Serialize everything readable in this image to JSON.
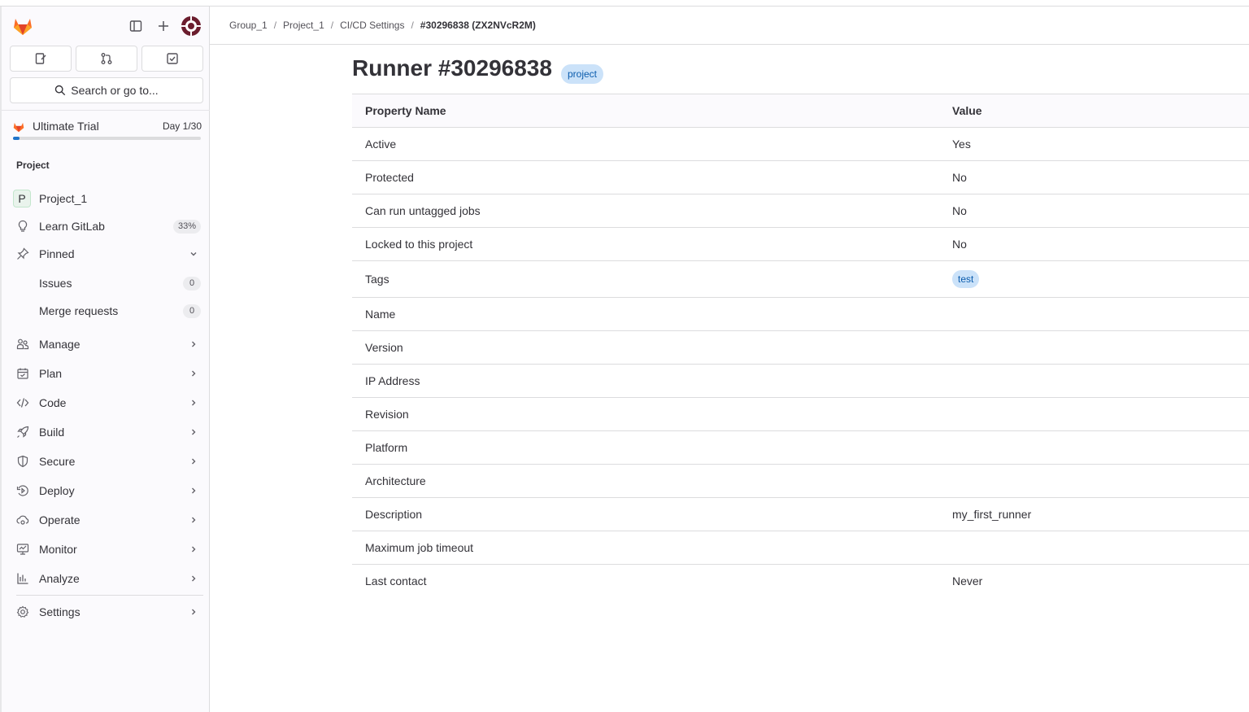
{
  "breadcrumb": [
    "Group_1",
    "Project_1",
    "CI/CD Settings",
    "#30296838 (ZX2NVcR2M)"
  ],
  "search": {
    "label": "Search or go to..."
  },
  "trial": {
    "title": "Ultimate Trial",
    "day": "Day 1/30",
    "progress": 0.033
  },
  "sidebar": {
    "section": "Project",
    "project": {
      "letter": "P",
      "name": "Project_1"
    },
    "learn": {
      "label": "Learn GitLab",
      "badge": "33%"
    },
    "pinned": {
      "label": "Pinned"
    },
    "pinned_items": [
      {
        "label": "Issues",
        "count": "0"
      },
      {
        "label": "Merge requests",
        "count": "0"
      }
    ],
    "items": [
      {
        "label": "Manage",
        "icon": "users-icon"
      },
      {
        "label": "Plan",
        "icon": "calendar-icon"
      },
      {
        "label": "Code",
        "icon": "code-icon"
      },
      {
        "label": "Build",
        "icon": "rocket-icon"
      },
      {
        "label": "Secure",
        "icon": "shield-icon"
      },
      {
        "label": "Deploy",
        "icon": "deploy-icon"
      },
      {
        "label": "Operate",
        "icon": "cloud-gear-icon"
      },
      {
        "label": "Monitor",
        "icon": "monitor-icon"
      },
      {
        "label": "Analyze",
        "icon": "chart-icon"
      }
    ],
    "settings": {
      "label": "Settings"
    }
  },
  "page": {
    "title": "Runner #30296838",
    "scope_badge": "project"
  },
  "table": {
    "headers": [
      "Property Name",
      "Value"
    ],
    "rows": [
      {
        "name": "Active",
        "value": "Yes"
      },
      {
        "name": "Protected",
        "value": "No"
      },
      {
        "name": "Can run untagged jobs",
        "value": "No"
      },
      {
        "name": "Locked to this project",
        "value": "No"
      },
      {
        "name": "Tags",
        "value": "test"
      },
      {
        "name": "Name",
        "value": ""
      },
      {
        "name": "Version",
        "value": ""
      },
      {
        "name": "IP Address",
        "value": ""
      },
      {
        "name": "Revision",
        "value": ""
      },
      {
        "name": "Platform",
        "value": ""
      },
      {
        "name": "Architecture",
        "value": ""
      },
      {
        "name": "Description",
        "value": "my_first_runner"
      },
      {
        "name": "Maximum job timeout",
        "value": ""
      },
      {
        "name": "Last contact",
        "value": "Never"
      }
    ]
  },
  "colors": {
    "accent": "#1f75cb",
    "badge_bg": "#cbe2f9",
    "badge_text": "#0b5cad",
    "logo": "#e24329"
  }
}
